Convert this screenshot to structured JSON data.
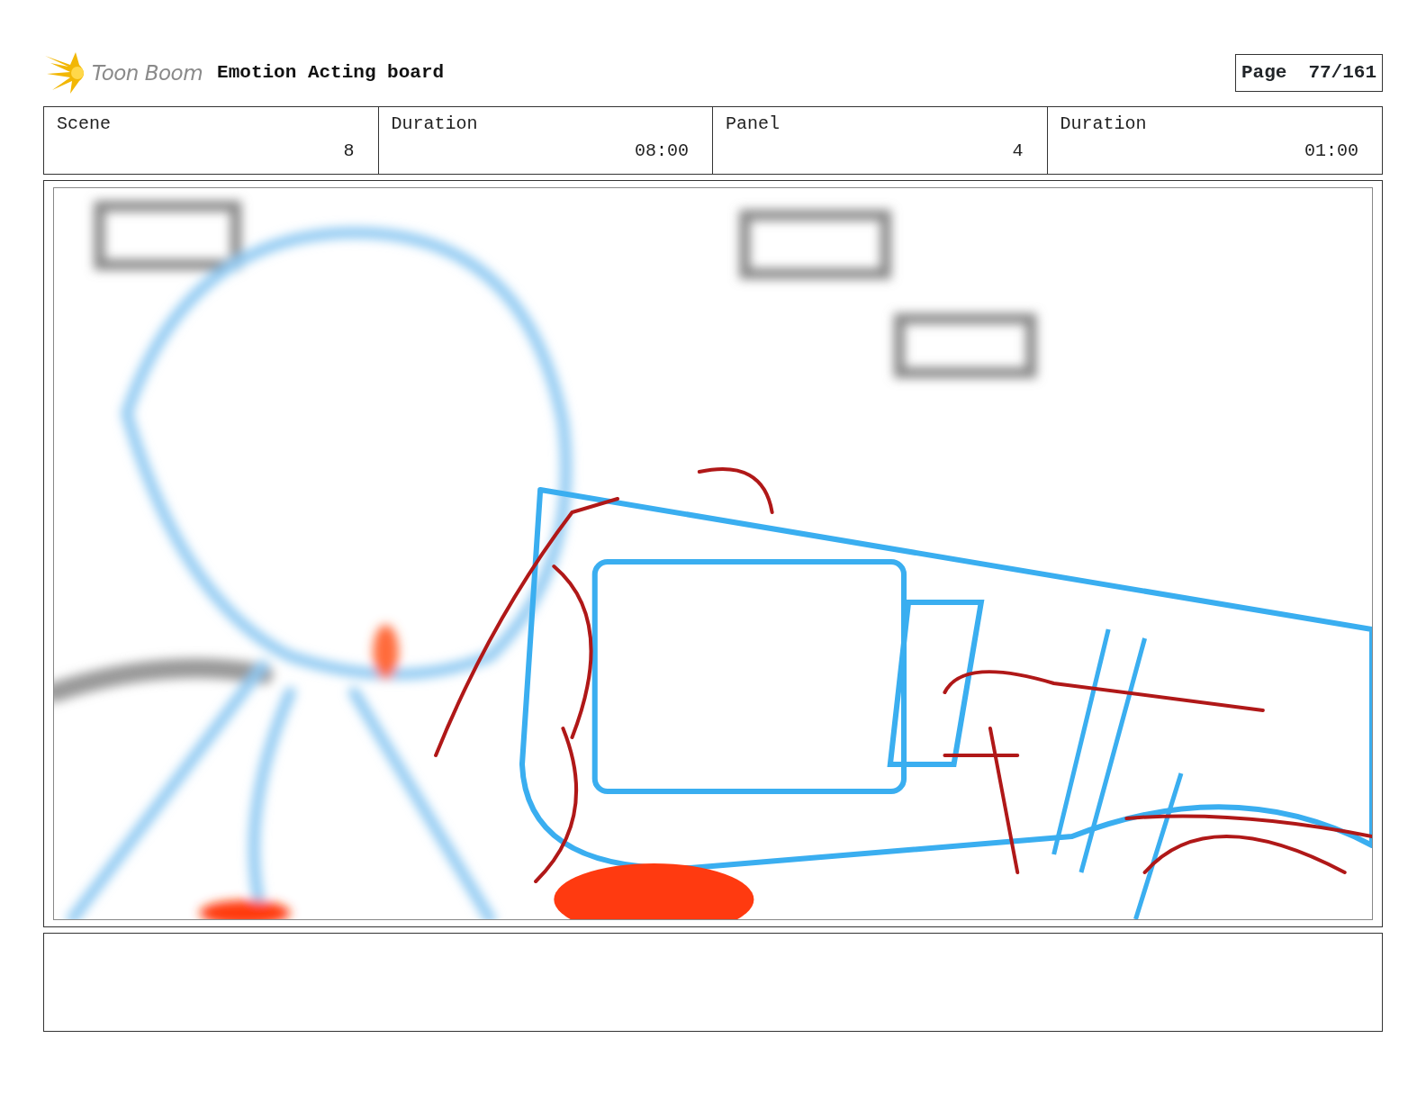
{
  "header": {
    "logo_text": "Toon Boom",
    "title": "Emotion Acting board",
    "page_label": "Page",
    "page_number": "77/161"
  },
  "info": [
    {
      "label": "Scene",
      "value": "8"
    },
    {
      "label": "Duration",
      "value": "08:00"
    },
    {
      "label": "Panel",
      "value": "4"
    },
    {
      "label": "Duration",
      "value": "01:00"
    }
  ]
}
